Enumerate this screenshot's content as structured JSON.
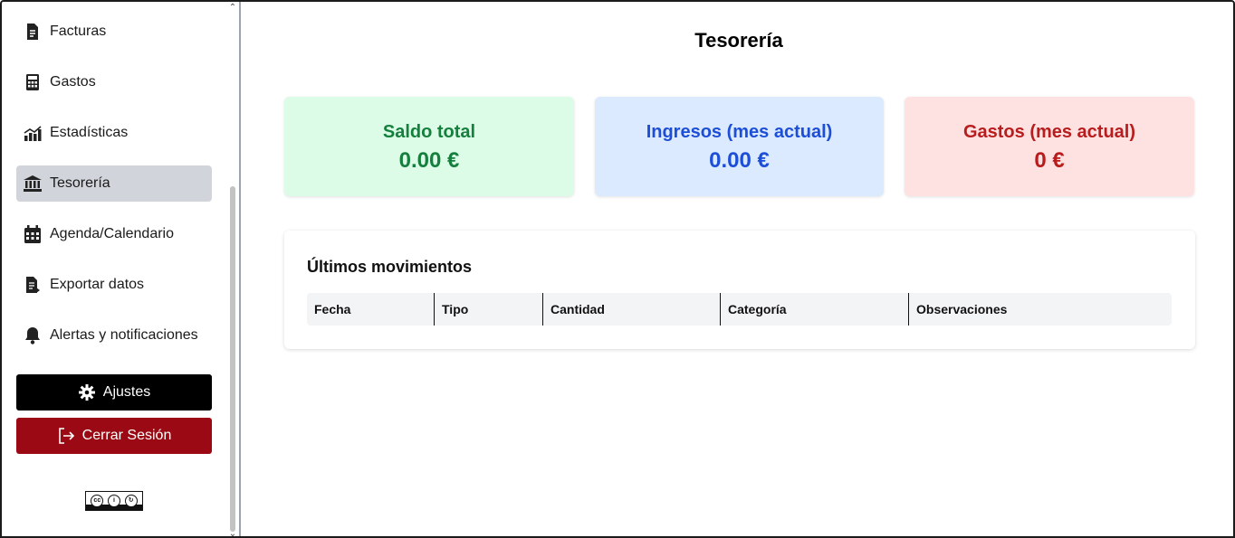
{
  "sidebar": {
    "items": [
      {
        "label": "Facturas",
        "icon": "invoice-icon"
      },
      {
        "label": "Gastos",
        "icon": "calculator-icon"
      },
      {
        "label": "Estadísticas",
        "icon": "chart-icon"
      },
      {
        "label": "Tesorería",
        "icon": "bank-icon",
        "active": true
      },
      {
        "label": "Agenda/Calendario",
        "icon": "calendar-icon"
      },
      {
        "label": "Exportar datos",
        "icon": "export-icon"
      },
      {
        "label": "Alertas y notificaciones",
        "icon": "bell-icon"
      }
    ],
    "settings_label": "Ajustes",
    "logout_label": "Cerrar Sesión",
    "license": {
      "by": "BY",
      "sa": "SA"
    }
  },
  "main": {
    "title": "Tesorería",
    "cards": [
      {
        "label": "Saldo total",
        "value": "0.00 €",
        "color": "#15803d",
        "bg": "#dcfce7"
      },
      {
        "label": "Ingresos (mes actual)",
        "value": "0.00 €",
        "color": "#1d4ed8",
        "bg": "#dbeafe"
      },
      {
        "label": "Gastos (mes actual)",
        "value": "0 €",
        "color": "#b91c1c",
        "bg": "#fee2e2"
      }
    ],
    "movements": {
      "title": "Últimos movimientos",
      "columns": [
        "Fecha",
        "Tipo",
        "Cantidad",
        "Categoría",
        "Observaciones"
      ]
    }
  },
  "colors": {
    "active_bg": "#d1d5db",
    "settings_bg": "#000000",
    "logout_bg": "#9b0a14"
  }
}
